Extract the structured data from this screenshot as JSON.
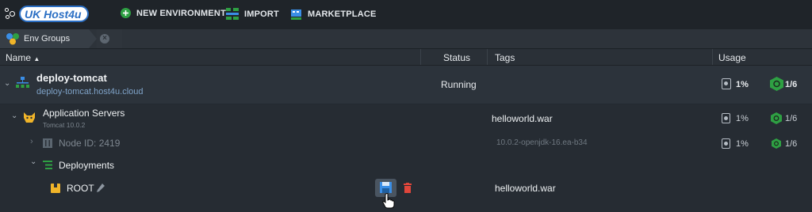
{
  "logo": {
    "text": "UK Host4u"
  },
  "topbar": {
    "new_env": "NEW ENVIRONMENT",
    "import": "IMPORT",
    "marketplace": "MARKETPLACE"
  },
  "breadcrumb": {
    "env_groups": "Env Groups"
  },
  "columns": {
    "name": "Name",
    "status": "Status",
    "tags": "Tags",
    "usage": "Usage"
  },
  "environment": {
    "name": "deploy-tomcat",
    "domain": "deploy-tomcat.host4u.cloud",
    "status": "Running",
    "usage_disk": "1%",
    "usage_cloudlets": "1/6"
  },
  "app_servers": {
    "label": "Application Servers",
    "sublabel": "Tomcat 10.0.2",
    "tag": "helloworld.war",
    "usage_disk": "1%",
    "usage_cloudlets": "1/6"
  },
  "node": {
    "label": "Node ID: 2419",
    "tag": "10.0.2-openjdk-16.ea-b34",
    "usage_disk": "1%",
    "usage_cloudlets": "1/6"
  },
  "deployments": {
    "label": "Deployments"
  },
  "root": {
    "label": "ROOT",
    "tag": "helloworld.war"
  },
  "colors": {
    "accent_green": "#2ea043",
    "delete_red": "#e0463b",
    "brand_blue": "#2b6fc4"
  }
}
